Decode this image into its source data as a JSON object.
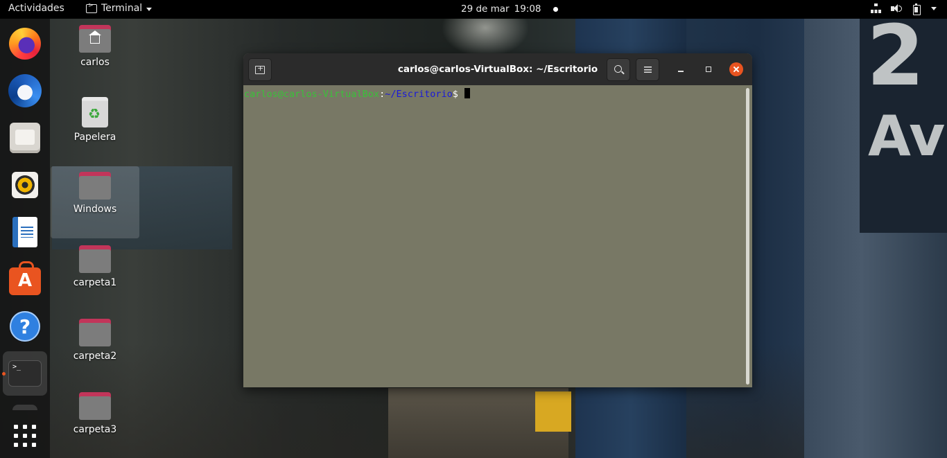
{
  "topbar": {
    "activities": "Actividades",
    "app_menu": "Terminal",
    "date": "29 de mar",
    "time": "19:08"
  },
  "dock": {
    "items": [
      {
        "name": "firefox",
        "icon": "firefox-icon"
      },
      {
        "name": "thunderbird",
        "icon": "thunderbird-icon"
      },
      {
        "name": "files",
        "icon": "files-icon"
      },
      {
        "name": "rhythmbox",
        "icon": "rhythmbox-icon"
      },
      {
        "name": "libreoffice-writer",
        "icon": "writer-icon"
      },
      {
        "name": "ubuntu-software",
        "icon": "software-store-icon"
      },
      {
        "name": "help",
        "icon": "help-icon"
      },
      {
        "name": "terminal",
        "icon": "terminal-icon",
        "running": true
      }
    ],
    "apps_grid_icon": "show-applications-icon",
    "accent": "#e95420"
  },
  "desktop": {
    "icons": [
      {
        "label": "carlos",
        "type": "home-folder"
      },
      {
        "label": "Papelera",
        "type": "trash"
      },
      {
        "label": "Windows",
        "type": "folder",
        "selected": true
      },
      {
        "label": "carpeta1",
        "type": "folder"
      },
      {
        "label": "carpeta2",
        "type": "folder"
      },
      {
        "label": "carpeta3",
        "type": "folder"
      }
    ]
  },
  "terminal": {
    "title": "carlos@carlos-VirtualBox: ~/Escritorio",
    "prompt_user": "carlos@carlos-VirtualBox",
    "prompt_colon": ":",
    "prompt_path": "~/Escritorio",
    "prompt_symbol": "$ ",
    "background": "#787865",
    "user_color": "#3ac13a",
    "path_color": "#1a1ad8"
  },
  "wallpaper": {
    "sign_number": "2",
    "sign_text": "Ave"
  }
}
